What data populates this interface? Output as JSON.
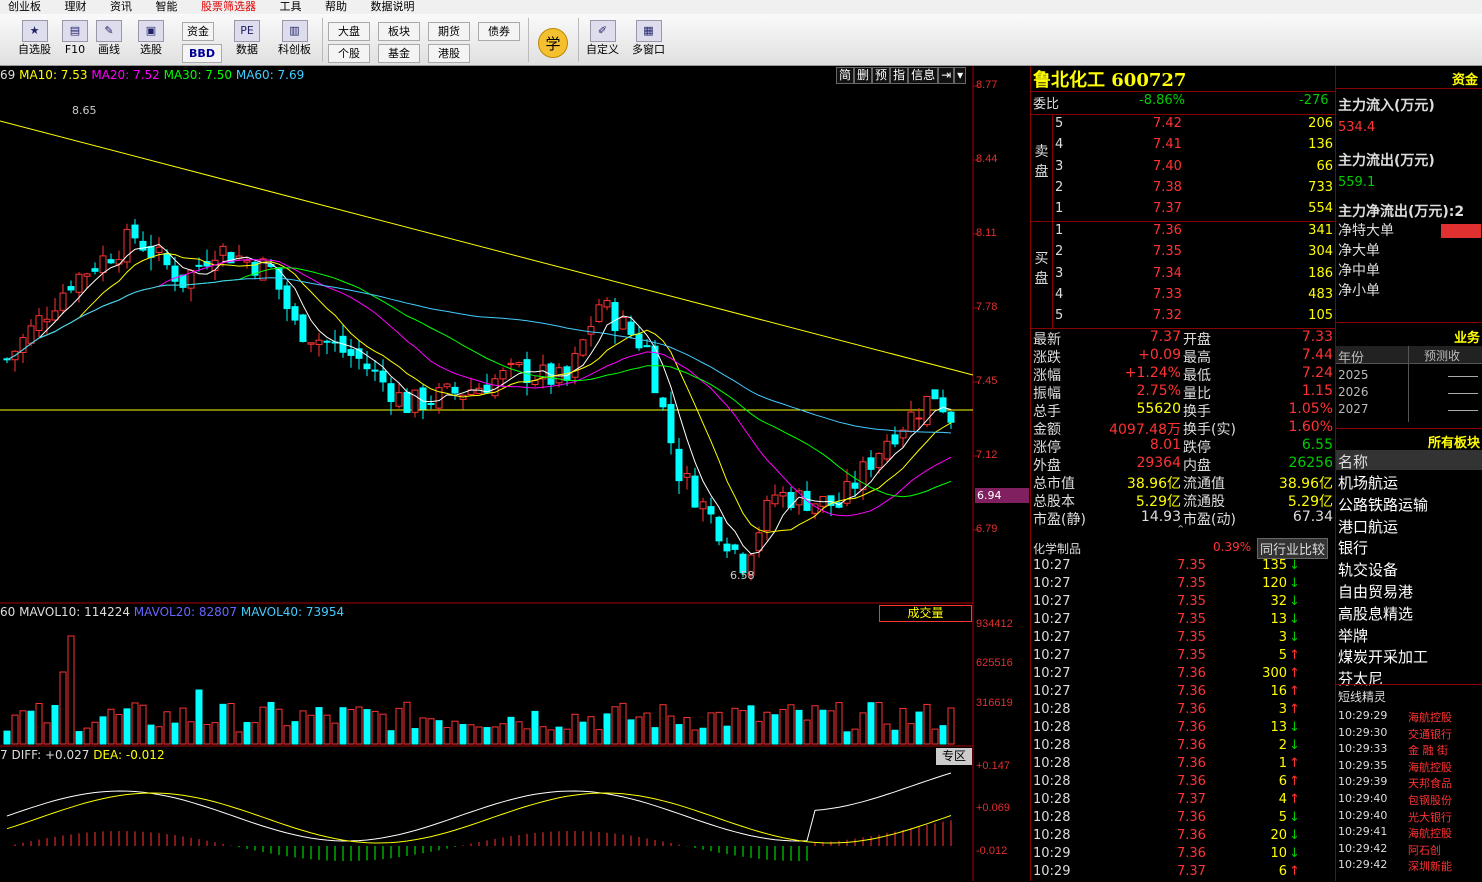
{
  "menubar": [
    "创业板",
    "理财",
    "资讯",
    "智能",
    "股票筛选器",
    "工具",
    "帮助",
    "数据说明"
  ],
  "toolbar": {
    "buttons": [
      {
        "label": "自选股",
        "icon": "star-icon"
      },
      {
        "label": "F10",
        "icon": "document-icon"
      },
      {
        "label": "画线",
        "icon": "pen-icon"
      },
      {
        "label": "选股",
        "icon": "filter-icon"
      },
      {
        "label": "数据",
        "icon": "pe-icon"
      },
      {
        "label": "科创板",
        "icon": "board-icon"
      },
      {
        "label": "自定义",
        "icon": "edit-icon"
      },
      {
        "label": "多窗口",
        "icon": "window-icon"
      }
    ],
    "zijin": "资金",
    "bbd": "BBD",
    "dapan": "大盘",
    "bankuai": "板块",
    "qihuo": "期货",
    "zhaiquan": "债券",
    "gegu": "个股",
    "jijin": "基金",
    "ganggu": "港股",
    "xue": "学"
  },
  "chart": {
    "ma_header": {
      "first": "69",
      "ma10": "MA10: 7.53",
      "ma20": "MA20: 7.52",
      "ma30": "MA30: 7.50",
      "ma60": "MA60: 7.69"
    },
    "tabs": [
      "简",
      "删",
      "预",
      "指",
      "信息"
    ],
    "price_axis": [
      "8.77",
      "8.44",
      "8.11",
      "7.78",
      "7.45",
      "7.12",
      "6.79"
    ],
    "current_price": "6.94",
    "high_label": "8.65",
    "low_label": "6.58",
    "vol_header": {
      "first": "60",
      "mavol10": "MAVOL10: 114224",
      "mavol20": "MAVOL20: 82807",
      "mavol40": "MAVOL40: 73954"
    },
    "vol_axis": [
      "934412",
      "625516",
      "316619"
    ],
    "vol_selector": "成交量",
    "macd_header": {
      "first": "7",
      "diff": "DIFF: +0.027",
      "dea": "DEA: -0.012"
    },
    "macd_axis": [
      "+0.147",
      "+0.069",
      "-0.012"
    ],
    "zq_button": "专区"
  },
  "quote": {
    "title": "鲁北化工  600727",
    "weibi_label": "委比",
    "weibi": "-8.86%",
    "weicha": "-276",
    "sell_label": [
      "卖",
      "盘"
    ],
    "buy_label": [
      "买",
      "盘"
    ],
    "sell": [
      [
        "5",
        "7.42",
        "206"
      ],
      [
        "4",
        "7.41",
        "136"
      ],
      [
        "3",
        "7.40",
        "66"
      ],
      [
        "2",
        "7.38",
        "733"
      ],
      [
        "1",
        "7.37",
        "554"
      ]
    ],
    "buy": [
      [
        "1",
        "7.36",
        "341"
      ],
      [
        "2",
        "7.35",
        "304"
      ],
      [
        "3",
        "7.34",
        "186"
      ],
      [
        "4",
        "7.33",
        "483"
      ],
      [
        "5",
        "7.32",
        "105"
      ]
    ],
    "stats": [
      [
        "最新",
        "7.37",
        "开盘",
        "7.33"
      ],
      [
        "涨跌",
        "+0.09",
        "最高",
        "7.44"
      ],
      [
        "涨幅",
        "+1.24%",
        "最低",
        "7.24"
      ],
      [
        "振幅",
        "2.75%",
        "量比",
        "1.15"
      ],
      [
        "总手",
        "55620",
        "换手",
        "1.05%"
      ],
      [
        "金额",
        "4097.48万",
        "换手(实)",
        "1.60%"
      ],
      [
        "涨停",
        "8.01",
        "跌停",
        "6.55"
      ],
      [
        "外盘",
        "29364",
        "内盘",
        "26256"
      ],
      [
        "总市值",
        "38.96亿",
        "流通值",
        "38.96亿"
      ],
      [
        "总股本",
        "5.29亿",
        "流通股",
        "5.29亿"
      ],
      [
        "市盈(静)",
        "14.93",
        "市盈(动)",
        "67.34"
      ]
    ],
    "industry": "化学制品",
    "industry_pct": "0.39%",
    "compare_btn": "同行业比较",
    "ticks": [
      [
        "10:27",
        "7.35",
        "135",
        "down"
      ],
      [
        "10:27",
        "7.35",
        "120",
        "down"
      ],
      [
        "10:27",
        "7.35",
        "32",
        "down"
      ],
      [
        "10:27",
        "7.35",
        "13",
        "down"
      ],
      [
        "10:27",
        "7.35",
        "3",
        "down"
      ],
      [
        "10:27",
        "7.35",
        "5",
        "up"
      ],
      [
        "10:27",
        "7.36",
        "300",
        "up"
      ],
      [
        "10:27",
        "7.36",
        "16",
        "up"
      ],
      [
        "10:28",
        "7.36",
        "3",
        "up"
      ],
      [
        "10:28",
        "7.36",
        "13",
        "down"
      ],
      [
        "10:28",
        "7.36",
        "2",
        "down"
      ],
      [
        "10:28",
        "7.36",
        "1",
        "up"
      ],
      [
        "10:28",
        "7.36",
        "6",
        "up"
      ],
      [
        "10:28",
        "7.37",
        "4",
        "up"
      ],
      [
        "10:28",
        "7.36",
        "5",
        "down"
      ],
      [
        "10:28",
        "7.36",
        "20",
        "down"
      ],
      [
        "10:29",
        "7.36",
        "10",
        "down"
      ],
      [
        "10:29",
        "7.37",
        "6",
        "up"
      ]
    ]
  },
  "side": {
    "tab": "资金",
    "inflow_label": "主力流入(万元)",
    "inflow": "534.4",
    "outflow_label": "主力流出(万元)",
    "outflow": "559.1",
    "net_label": "主力净流出(万元):2",
    "flows": [
      "净特大单",
      "净大单",
      "净中单",
      "净小单"
    ],
    "perf_tab": "业务",
    "year_hdr": "年份",
    "pred_hdr": "预测收",
    "years": [
      "2025",
      "2026",
      "2027"
    ],
    "boards_tab": "所有板块",
    "name_hdr": "名称",
    "boards": [
      "机场航运",
      "公路铁路运输",
      "港口航运",
      "银行",
      "轨交设备",
      "自由贸易港",
      "高股息精选",
      "举牌",
      "煤炭开采加工",
      "芬太尼"
    ],
    "sprite_hdr": "短线精灵",
    "sprites": [
      [
        "10:29:29",
        "海航控股"
      ],
      [
        "10:29:30",
        "交通银行"
      ],
      [
        "10:29:33",
        "金 融 街"
      ],
      [
        "10:29:35",
        "海航控股"
      ],
      [
        "10:29:39",
        "天邦食品"
      ],
      [
        "10:29:40",
        "包钢股份"
      ],
      [
        "10:29:40",
        "光大银行"
      ],
      [
        "10:29:41",
        "海航控股"
      ],
      [
        "10:29:42",
        "阿石创"
      ],
      [
        "10:29:42",
        "深圳新能"
      ]
    ]
  }
}
